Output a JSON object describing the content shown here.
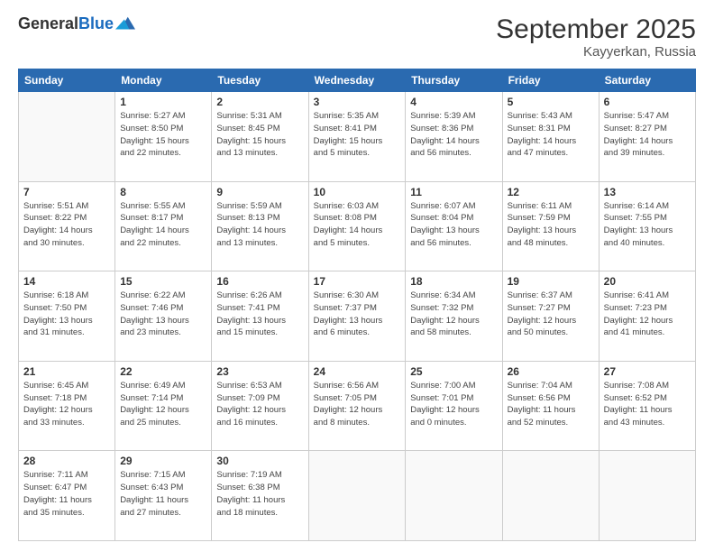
{
  "header": {
    "logo_general": "General",
    "logo_blue": "Blue",
    "month_title": "September 2025",
    "location": "Kayyerkan, Russia"
  },
  "weekdays": [
    "Sunday",
    "Monday",
    "Tuesday",
    "Wednesday",
    "Thursday",
    "Friday",
    "Saturday"
  ],
  "weeks": [
    [
      {
        "day": "",
        "info": ""
      },
      {
        "day": "1",
        "info": "Sunrise: 5:27 AM\nSunset: 8:50 PM\nDaylight: 15 hours\nand 22 minutes."
      },
      {
        "day": "2",
        "info": "Sunrise: 5:31 AM\nSunset: 8:45 PM\nDaylight: 15 hours\nand 13 minutes."
      },
      {
        "day": "3",
        "info": "Sunrise: 5:35 AM\nSunset: 8:41 PM\nDaylight: 15 hours\nand 5 minutes."
      },
      {
        "day": "4",
        "info": "Sunrise: 5:39 AM\nSunset: 8:36 PM\nDaylight: 14 hours\nand 56 minutes."
      },
      {
        "day": "5",
        "info": "Sunrise: 5:43 AM\nSunset: 8:31 PM\nDaylight: 14 hours\nand 47 minutes."
      },
      {
        "day": "6",
        "info": "Sunrise: 5:47 AM\nSunset: 8:27 PM\nDaylight: 14 hours\nand 39 minutes."
      }
    ],
    [
      {
        "day": "7",
        "info": "Sunrise: 5:51 AM\nSunset: 8:22 PM\nDaylight: 14 hours\nand 30 minutes."
      },
      {
        "day": "8",
        "info": "Sunrise: 5:55 AM\nSunset: 8:17 PM\nDaylight: 14 hours\nand 22 minutes."
      },
      {
        "day": "9",
        "info": "Sunrise: 5:59 AM\nSunset: 8:13 PM\nDaylight: 14 hours\nand 13 minutes."
      },
      {
        "day": "10",
        "info": "Sunrise: 6:03 AM\nSunset: 8:08 PM\nDaylight: 14 hours\nand 5 minutes."
      },
      {
        "day": "11",
        "info": "Sunrise: 6:07 AM\nSunset: 8:04 PM\nDaylight: 13 hours\nand 56 minutes."
      },
      {
        "day": "12",
        "info": "Sunrise: 6:11 AM\nSunset: 7:59 PM\nDaylight: 13 hours\nand 48 minutes."
      },
      {
        "day": "13",
        "info": "Sunrise: 6:14 AM\nSunset: 7:55 PM\nDaylight: 13 hours\nand 40 minutes."
      }
    ],
    [
      {
        "day": "14",
        "info": "Sunrise: 6:18 AM\nSunset: 7:50 PM\nDaylight: 13 hours\nand 31 minutes."
      },
      {
        "day": "15",
        "info": "Sunrise: 6:22 AM\nSunset: 7:46 PM\nDaylight: 13 hours\nand 23 minutes."
      },
      {
        "day": "16",
        "info": "Sunrise: 6:26 AM\nSunset: 7:41 PM\nDaylight: 13 hours\nand 15 minutes."
      },
      {
        "day": "17",
        "info": "Sunrise: 6:30 AM\nSunset: 7:37 PM\nDaylight: 13 hours\nand 6 minutes."
      },
      {
        "day": "18",
        "info": "Sunrise: 6:34 AM\nSunset: 7:32 PM\nDaylight: 12 hours\nand 58 minutes."
      },
      {
        "day": "19",
        "info": "Sunrise: 6:37 AM\nSunset: 7:27 PM\nDaylight: 12 hours\nand 50 minutes."
      },
      {
        "day": "20",
        "info": "Sunrise: 6:41 AM\nSunset: 7:23 PM\nDaylight: 12 hours\nand 41 minutes."
      }
    ],
    [
      {
        "day": "21",
        "info": "Sunrise: 6:45 AM\nSunset: 7:18 PM\nDaylight: 12 hours\nand 33 minutes."
      },
      {
        "day": "22",
        "info": "Sunrise: 6:49 AM\nSunset: 7:14 PM\nDaylight: 12 hours\nand 25 minutes."
      },
      {
        "day": "23",
        "info": "Sunrise: 6:53 AM\nSunset: 7:09 PM\nDaylight: 12 hours\nand 16 minutes."
      },
      {
        "day": "24",
        "info": "Sunrise: 6:56 AM\nSunset: 7:05 PM\nDaylight: 12 hours\nand 8 minutes."
      },
      {
        "day": "25",
        "info": "Sunrise: 7:00 AM\nSunset: 7:01 PM\nDaylight: 12 hours\nand 0 minutes."
      },
      {
        "day": "26",
        "info": "Sunrise: 7:04 AM\nSunset: 6:56 PM\nDaylight: 11 hours\nand 52 minutes."
      },
      {
        "day": "27",
        "info": "Sunrise: 7:08 AM\nSunset: 6:52 PM\nDaylight: 11 hours\nand 43 minutes."
      }
    ],
    [
      {
        "day": "28",
        "info": "Sunrise: 7:11 AM\nSunset: 6:47 PM\nDaylight: 11 hours\nand 35 minutes."
      },
      {
        "day": "29",
        "info": "Sunrise: 7:15 AM\nSunset: 6:43 PM\nDaylight: 11 hours\nand 27 minutes."
      },
      {
        "day": "30",
        "info": "Sunrise: 7:19 AM\nSunset: 6:38 PM\nDaylight: 11 hours\nand 18 minutes."
      },
      {
        "day": "",
        "info": ""
      },
      {
        "day": "",
        "info": ""
      },
      {
        "day": "",
        "info": ""
      },
      {
        "day": "",
        "info": ""
      }
    ]
  ]
}
